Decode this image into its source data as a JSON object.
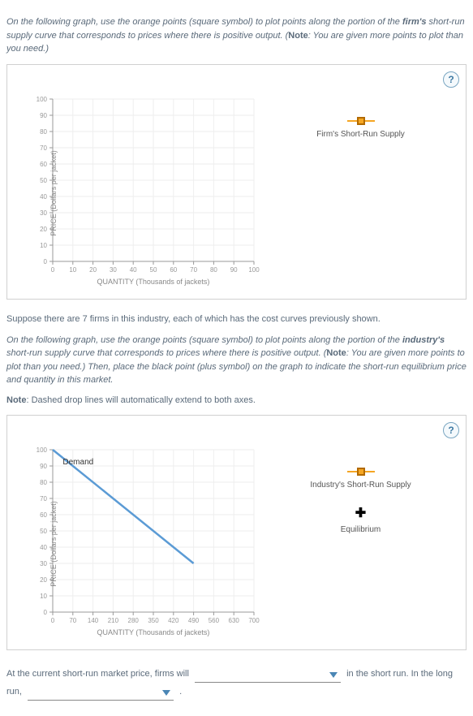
{
  "instruction1": {
    "pre": "On the following graph, use the orange points (square symbol) to plot points along the portion of the ",
    "bold1": "firm's",
    "mid": " short-run supply curve that corresponds to prices where there is positive output. (",
    "note_bold": "Note",
    "post": ": You are given more points to plot than you need.)"
  },
  "graph1": {
    "help": "?",
    "ylabel": "PRICE (Dollars per jacket)",
    "xlabel": "QUANTITY (Thousands of jackets)",
    "legend": {
      "label": "Firm's Short-Run Supply"
    },
    "yticks": [
      "0",
      "10",
      "20",
      "30",
      "40",
      "50",
      "60",
      "70",
      "80",
      "90",
      "100"
    ],
    "xticks": [
      "0",
      "10",
      "20",
      "30",
      "40",
      "50",
      "60",
      "70",
      "80",
      "90",
      "100"
    ]
  },
  "between_text": "Suppose there are 7 firms in this industry, each of which has the cost curves previously shown.",
  "instruction2": {
    "pre": "On the following graph, use the orange points (square symbol) to plot points along the portion of the ",
    "bold1": "industry's",
    "mid": " short-run supply curve that corresponds to prices where there is positive output. (",
    "note_bold": "Note",
    "post": ": You are given more points to plot than you need.) Then, place the black point (plus symbol) on the graph to indicate the short-run equilibrium price and quantity in this market."
  },
  "note2": {
    "bold": "Note",
    "text": ": Dashed drop lines will automatically extend to both axes."
  },
  "graph2": {
    "help": "?",
    "ylabel": "PRICE (Dollars per jacket)",
    "xlabel": "QUANTITY (Thousands of jackets)",
    "demand_label": "Demand",
    "legend": {
      "supply": "Industry's Short-Run Supply",
      "eq": "Equilibrium"
    },
    "yticks": [
      "0",
      "10",
      "20",
      "30",
      "40",
      "50",
      "60",
      "70",
      "80",
      "90",
      "100"
    ],
    "xticks": [
      "0",
      "70",
      "140",
      "210",
      "280",
      "350",
      "420",
      "490",
      "560",
      "630",
      "700"
    ]
  },
  "fill": {
    "pre": "At the current short-run market price, firms will",
    "mid": "in the short run. In the long run,",
    "post": "."
  },
  "chart_data": [
    {
      "id": "graph1",
      "type": "scatter",
      "title": "",
      "xlabel": "QUANTITY (Thousands of jackets)",
      "ylabel": "PRICE (Dollars per jacket)",
      "xlim": [
        0,
        100
      ],
      "ylim": [
        0,
        100
      ],
      "xticks": [
        0,
        10,
        20,
        30,
        40,
        50,
        60,
        70,
        80,
        90,
        100
      ],
      "yticks": [
        0,
        10,
        20,
        30,
        40,
        50,
        60,
        70,
        80,
        90,
        100
      ],
      "grid": true,
      "legend_position": "right",
      "series": [
        {
          "name": "Firm's Short-Run Supply",
          "marker": "square",
          "color": "#f5a623",
          "x": [],
          "y": []
        }
      ]
    },
    {
      "id": "graph2",
      "type": "line",
      "title": "",
      "xlabel": "QUANTITY (Thousands of jackets)",
      "ylabel": "PRICE (Dollars per jacket)",
      "xlim": [
        0,
        700
      ],
      "ylim": [
        0,
        100
      ],
      "xticks": [
        0,
        70,
        140,
        210,
        280,
        350,
        420,
        490,
        560,
        630,
        700
      ],
      "yticks": [
        0,
        10,
        20,
        30,
        40,
        50,
        60,
        70,
        80,
        90,
        100
      ],
      "grid": true,
      "legend_position": "right",
      "series": [
        {
          "name": "Demand",
          "type": "line",
          "color": "#5b9bd5",
          "x": [
            0,
            490
          ],
          "y": [
            100,
            30
          ]
        },
        {
          "name": "Industry's Short-Run Supply",
          "type": "scatter",
          "marker": "square",
          "color": "#f5a623",
          "x": [],
          "y": []
        },
        {
          "name": "Equilibrium",
          "type": "scatter",
          "marker": "plus",
          "color": "#000000",
          "x": [],
          "y": []
        }
      ]
    }
  ]
}
